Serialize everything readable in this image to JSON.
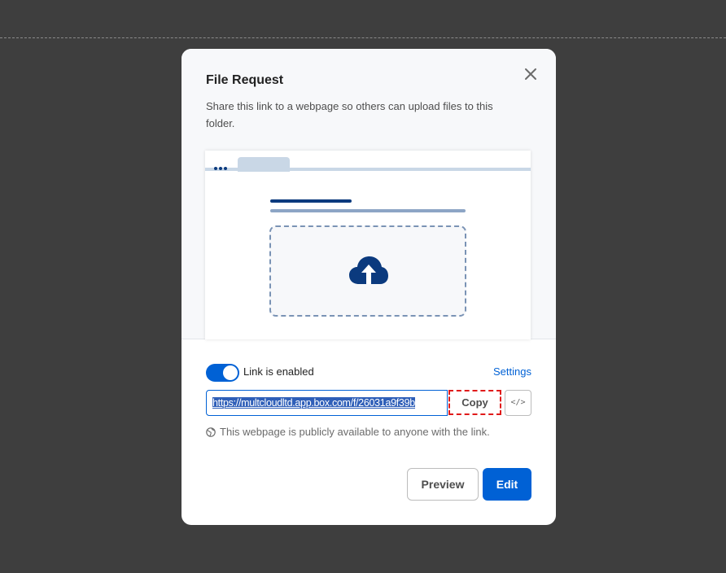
{
  "modal": {
    "title": "File Request",
    "description": "Share this link to a webpage so others can upload files to this folder.",
    "close_icon": "close-icon"
  },
  "illustration": {
    "upload_icon": "cloud-upload-icon",
    "accent_color": "#0b3a7e"
  },
  "link": {
    "toggle_enabled": true,
    "toggle_label": "Link is enabled",
    "settings_label": "Settings",
    "url": "https://multcloudltd.app.box.com/f/26031a9f39b",
    "copy_label": "Copy",
    "embed_label": "</>",
    "public_note": "This webpage is publicly available to anyone with the link.",
    "globe_icon": "globe-icon"
  },
  "footer": {
    "preview_label": "Preview",
    "edit_label": "Edit"
  },
  "colors": {
    "primary": "#0061d5",
    "backdrop": "#3e3e3e",
    "highlight_border": "#e01a1a"
  }
}
